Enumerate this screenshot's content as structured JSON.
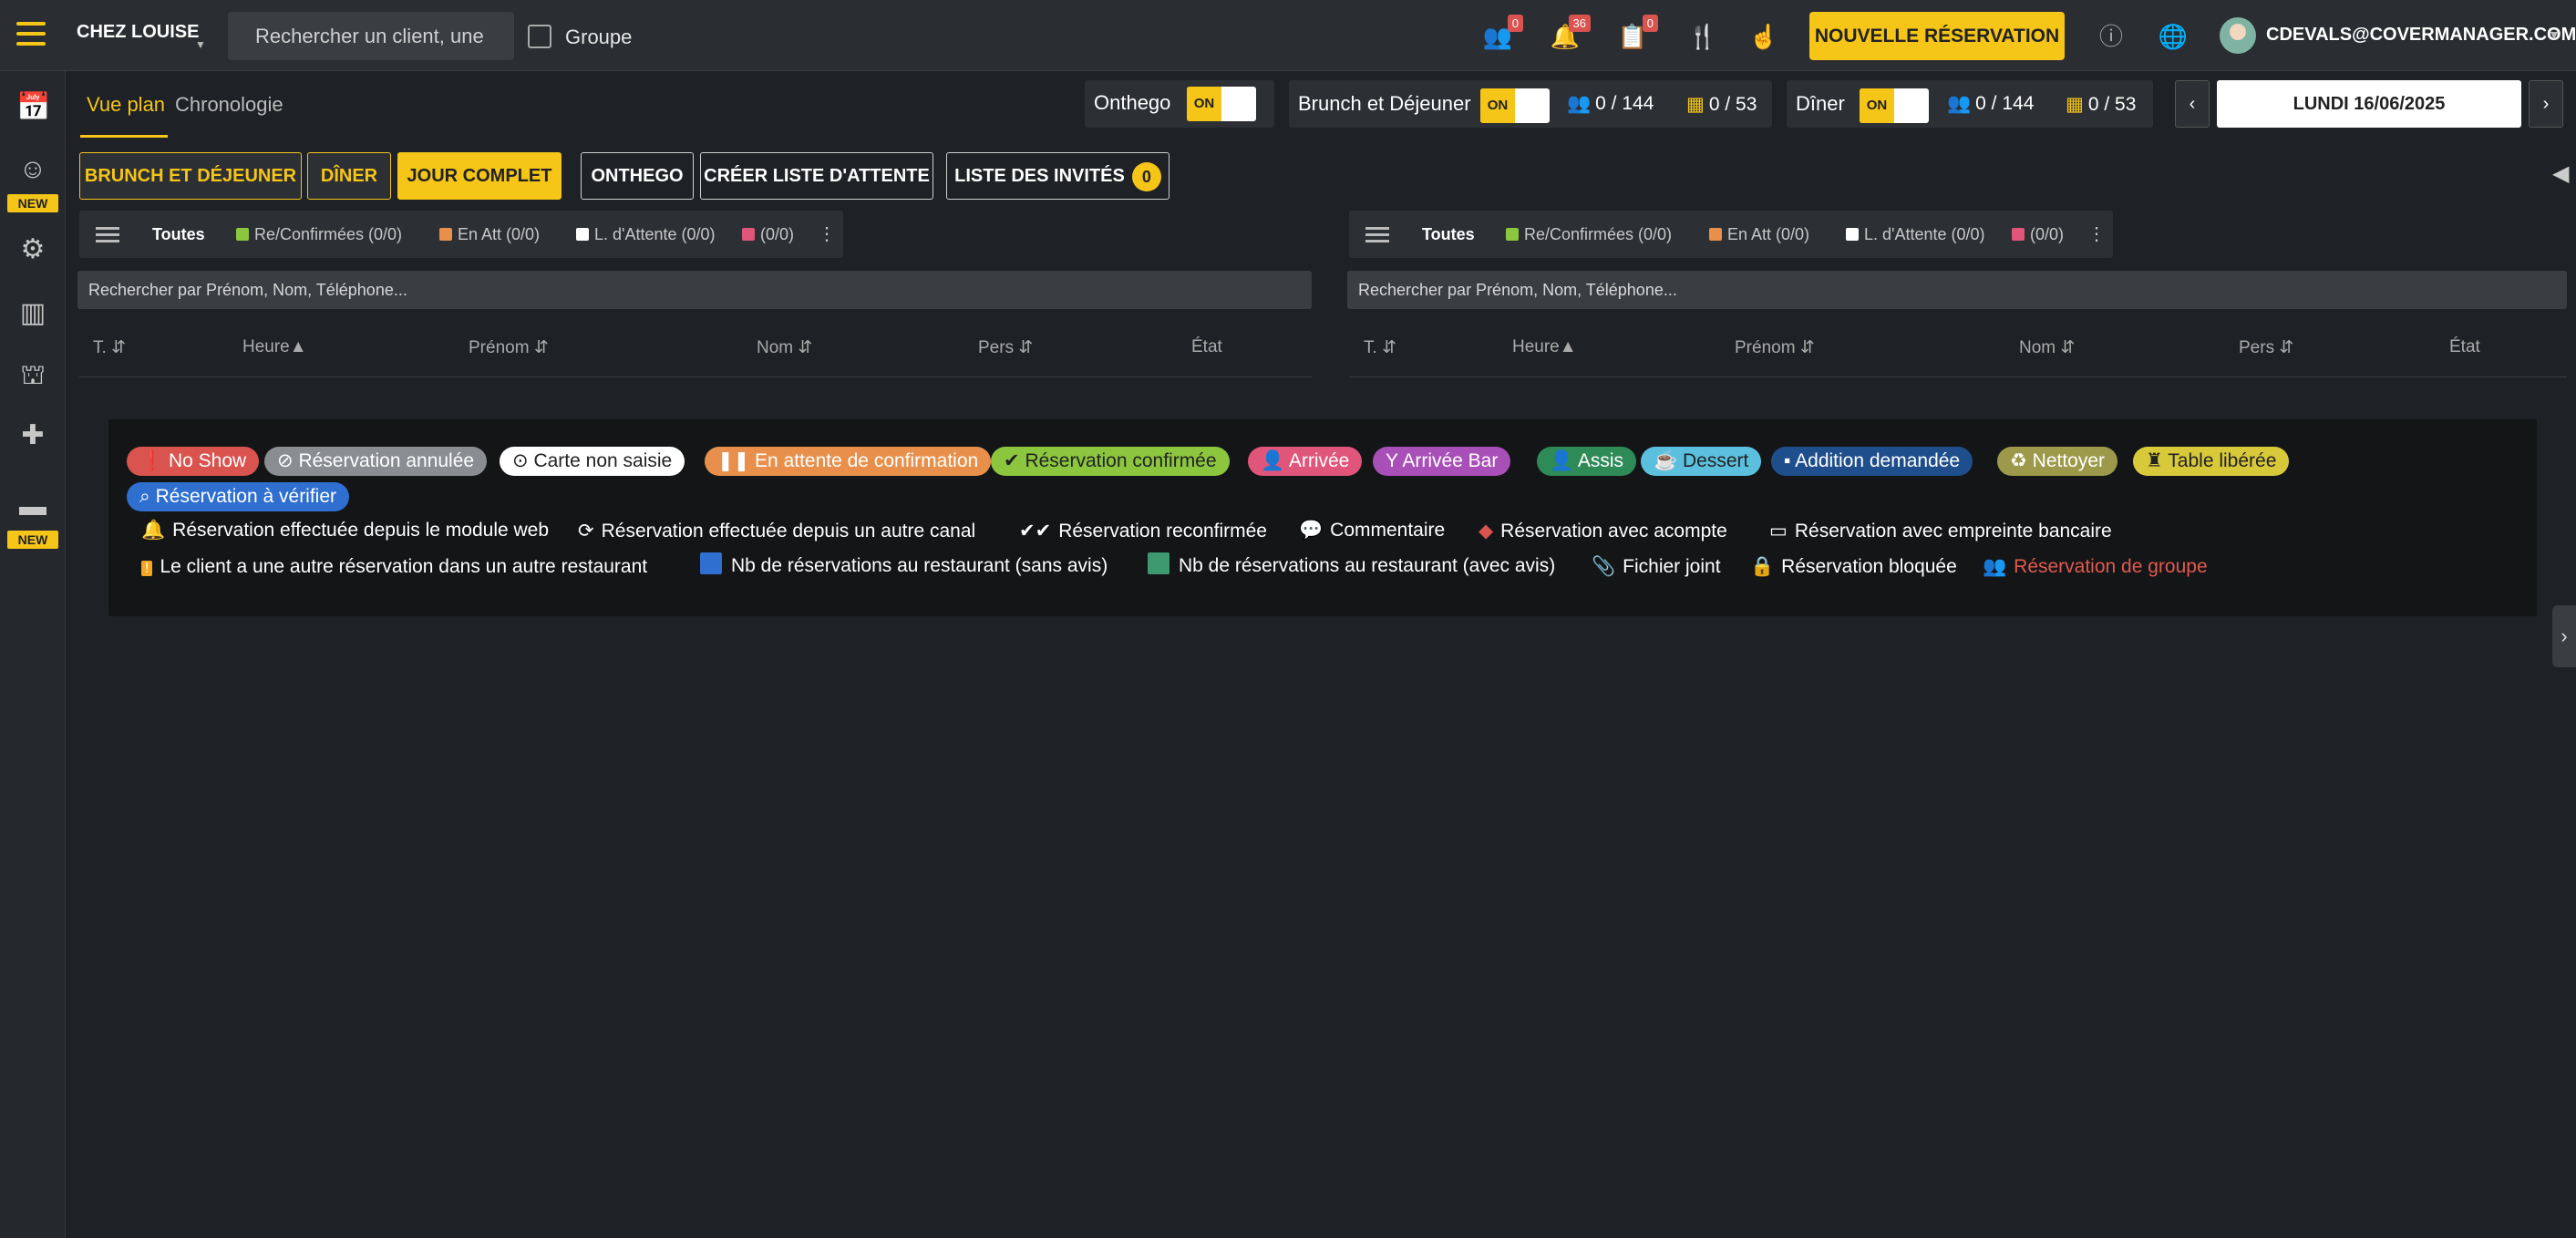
{
  "header": {
    "restaurant": "CHEZ LOUISE",
    "search_placeholder": "Rechercher un client, une re",
    "group_label": "Groupe",
    "badges": {
      "walkin": "0",
      "notifications": "36",
      "tasks": "0"
    },
    "new_reservation": "NOUVELLE RÉSERVATION",
    "user_email": "CDEVALS@COVERMANAGER.COM"
  },
  "sidebar": {
    "new_label_1": "NEW",
    "new_label_2": "NEW"
  },
  "views": {
    "plan": "Vue plan",
    "chronologie": "Chronologie"
  },
  "services": {
    "onthego": {
      "label": "Onthego",
      "toggle": "ON"
    },
    "brunch": {
      "label": "Brunch et Déjeuner",
      "toggle": "ON",
      "covers": "0 / 144",
      "tables": "0 / 53"
    },
    "diner": {
      "label": "Dîner",
      "toggle": "ON",
      "covers": "0 / 144",
      "tables": "0 / 53"
    }
  },
  "date": {
    "label": "LUNDI 16/06/2025",
    "prev": "‹",
    "next": "›"
  },
  "service_buttons": {
    "brunch": "BRUNCH ET DÉJEUNER",
    "diner": "DÎNER",
    "full": "JOUR COMPLET"
  },
  "action_buttons": {
    "onthego": "ONTHEGO",
    "waitlist": "CRÉER LISTE D'ATTENTE",
    "guests": "LISTE DES INVITÉS",
    "guests_count": "0"
  },
  "filters": {
    "toutes": "Toutes",
    "confirmed": "Re/Confirmées (0/0)",
    "pending": "En Att (0/0)",
    "waiting": "L. d'Attente (0/0)",
    "other": "(0/0)"
  },
  "list_search_placeholder": "Rechercher par Prénom, Nom, Téléphone...",
  "columns": {
    "table": "T.",
    "hour": "Heure",
    "firstname": "Prénom",
    "lastname": "Nom",
    "pax": "Pers",
    "state": "État"
  },
  "legend": {
    "statuses": [
      {
        "label": "No Show",
        "icon": "!",
        "bg": "#d9534f",
        "fg": "#ffffff"
      },
      {
        "label": "Réservation annulée",
        "icon": "⊘",
        "bg": "#8a8d92",
        "fg": "#ffffff"
      },
      {
        "label": "Carte non saisie",
        "icon": "⊙",
        "bg": "#ffffff",
        "fg": "#222222"
      },
      {
        "label": "En attente de confirmation",
        "icon": "▮▮",
        "bg": "#e8904b",
        "fg": "#ffffff"
      },
      {
        "label": "Réservation confirmée",
        "icon": "✔",
        "bg": "#8cc63f",
        "fg": "#222222"
      },
      {
        "label": "Arrivée",
        "icon": "👤+",
        "bg": "#e0557a",
        "fg": "#ffffff"
      },
      {
        "label": "Arrivée Bar",
        "icon": "Y",
        "bg": "#a84fb8",
        "fg": "#ffffff"
      },
      {
        "label": "Assis",
        "icon": "👤",
        "bg": "#2e8b57",
        "fg": "#ffffff"
      },
      {
        "label": "Dessert",
        "icon": "☕",
        "bg": "#5bc0de",
        "fg": "#222222"
      },
      {
        "label": "Addition demandée",
        "icon": "▪",
        "bg": "#1f4e8c",
        "fg": "#ffffff"
      },
      {
        "label": "Nettoyer",
        "icon": "♻",
        "bg": "#9c9a4a",
        "fg": "#ffffff"
      },
      {
        "label": "Table libérée",
        "icon": "♜",
        "bg": "#d8c93a",
        "fg": "#222222"
      },
      {
        "label": "Réservation à vérifier",
        "icon": "⌕",
        "bg": "#2f6fd0",
        "fg": "#ffffff"
      }
    ],
    "icons": [
      {
        "label": "Réservation effectuée depuis le module web",
        "icon": "bell-icon"
      },
      {
        "label": "Réservation effectuée depuis un autre canal",
        "icon": "spinner-icon"
      },
      {
        "label": "Réservation reconfirmée",
        "icon": "double-check-icon"
      },
      {
        "label": "Commentaire",
        "icon": "comment-icon"
      },
      {
        "label": "Réservation avec acompte",
        "icon": "money-icon"
      },
      {
        "label": "Réservation avec empreinte bancaire",
        "icon": "card-icon"
      },
      {
        "label": "Le client a une autre réservation dans un autre restaurant",
        "icon": "warning-icon"
      },
      {
        "label": "Nb de réservations au restaurant (sans avis)",
        "icon": "blue-square-icon"
      },
      {
        "label": "Nb de réservations au restaurant (avec avis)",
        "icon": "green-square-icon"
      },
      {
        "label": "Fichier joint",
        "icon": "paperclip-icon"
      },
      {
        "label": "Réservation bloquée",
        "icon": "lock-icon"
      },
      {
        "label": "Réservation de groupe",
        "icon": "group-icon"
      }
    ]
  },
  "colors": {
    "accent": "#f5c518",
    "background": "#1e2125",
    "topbar": "#2a2d31",
    "group_text": "#e05a4f"
  }
}
